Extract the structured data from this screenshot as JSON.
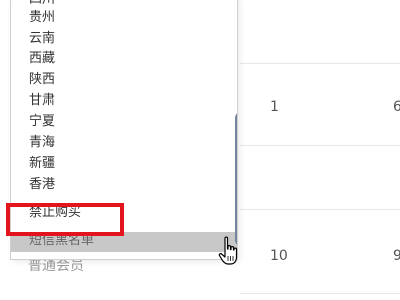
{
  "table": {
    "row1": {
      "col_a": "1",
      "col_b": "6"
    },
    "row2": {
      "col_a": "10",
      "col_b": "9"
    },
    "partial_left_text": "普通会员"
  },
  "dropdown": {
    "items": [
      {
        "label": "四川"
      },
      {
        "label": "贵州"
      },
      {
        "label": "云南"
      },
      {
        "label": "西藏"
      },
      {
        "label": "陕西"
      },
      {
        "label": "甘肃"
      },
      {
        "label": "宁夏"
      },
      {
        "label": "青海"
      },
      {
        "label": "新疆"
      },
      {
        "label": "香港"
      },
      {
        "label": "禁止购买"
      },
      {
        "label": "短信黑名单"
      }
    ],
    "hovered_item": "短信黑名单"
  },
  "colors": {
    "highlight_border": "#e3141c",
    "scrollbar": "#7783a0",
    "hover_row_bg": "#c8c8c8"
  },
  "icons": {
    "cursor": "hand-pointer-icon"
  }
}
